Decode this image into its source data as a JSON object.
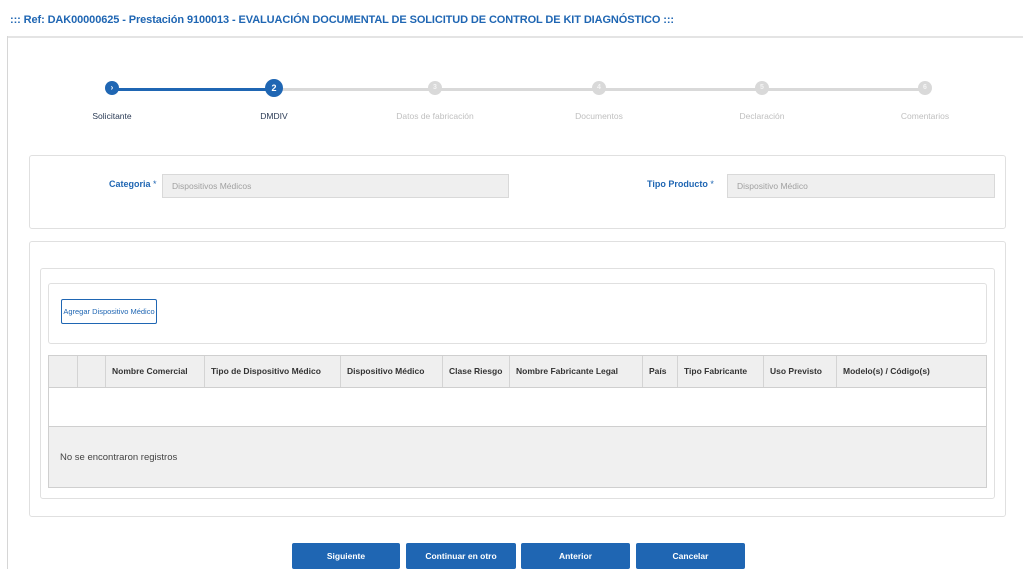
{
  "page_title": "::: Ref: DAK00000625 - Prestación 9100013 - EVALUACIÓN DOCUMENTAL DE SOLICITUD DE CONTROL DE KIT DIAGNÓSTICO :::",
  "stepper": {
    "steps": [
      {
        "number": "›",
        "label": "Solicitante",
        "state": "done"
      },
      {
        "number": "2",
        "label": "DMDIV",
        "state": "active"
      },
      {
        "number": "3",
        "label": "Datos de fabricación",
        "state": "pending"
      },
      {
        "number": "4",
        "label": "Documentos",
        "state": "pending"
      },
      {
        "number": "5",
        "label": "Declaración",
        "state": "pending"
      },
      {
        "number": "6",
        "label": "Comentarios",
        "state": "pending"
      }
    ]
  },
  "form": {
    "categoria_label": "Categoria",
    "categoria_required": "*",
    "categoria_value": "Dispositivos Médicos",
    "tipo_producto_label": "Tipo Producto",
    "tipo_producto_required": "*",
    "tipo_producto_value": "Dispositivo Médico"
  },
  "devices": {
    "add_button": "Agregar Dispositivo Médico",
    "columns": [
      "",
      "",
      "Nombre Comercial",
      "Tipo de Dispositivo Médico",
      "Dispositivo Médico",
      "Clase Riesgo",
      "Nombre Fabricante Legal",
      "País",
      "Tipo Fabricante",
      "Uso Previsto",
      "Modelo(s) / Código(s)"
    ],
    "empty_message": "No se encontraron registros"
  },
  "actions": {
    "next": "Siguiente",
    "continue_later": "Continuar en otro momento",
    "previous": "Anterior",
    "cancel": "Cancelar"
  },
  "colors": {
    "primary": "#1f66b3",
    "inactive": "#d9d9d9"
  }
}
